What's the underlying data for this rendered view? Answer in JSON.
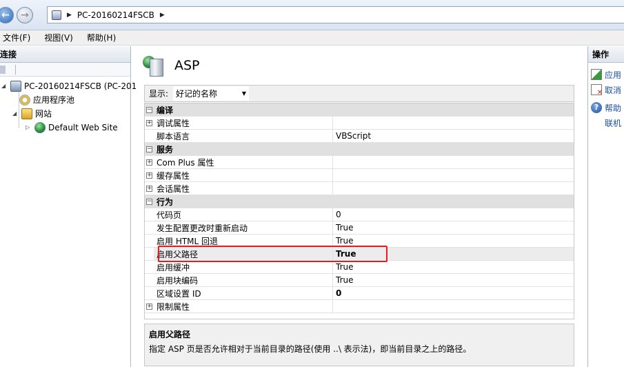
{
  "address": {
    "path": "PC-20160214FSCB"
  },
  "menu": [
    "文件(F)",
    "视图(V)",
    "帮助(H)"
  ],
  "connections": {
    "title": "连接",
    "tree": [
      {
        "label": "PC-20160214FSCB (PC-201"
      },
      {
        "label": "应用程序池"
      },
      {
        "label": "网站"
      },
      {
        "label": "Default Web Site"
      }
    ]
  },
  "feature": {
    "title": "ASP",
    "display_label": "显示:",
    "display_value": "好记的名称",
    "rows": [
      {
        "name": "编译",
        "value": "",
        "category": true
      },
      {
        "name": "调试属性",
        "value": ""
      },
      {
        "name": "脚本语言",
        "value": "VBScript"
      },
      {
        "name": "服务",
        "value": "",
        "category": true
      },
      {
        "name": "Com Plus 属性",
        "value": ""
      },
      {
        "name": "缓存属性",
        "value": ""
      },
      {
        "name": "会话属性",
        "value": ""
      },
      {
        "name": "行为",
        "value": "",
        "category": true
      },
      {
        "name": "代码页",
        "value": "0"
      },
      {
        "name": "发生配置更改时重新启动",
        "value": "True"
      },
      {
        "name": "启用 HTML 回退",
        "value": "True"
      },
      {
        "name": "启用父路径",
        "value": "True",
        "bold": true,
        "highlighted": true
      },
      {
        "name": "启用缓冲",
        "value": "True"
      },
      {
        "name": "启用块编码",
        "value": "True"
      },
      {
        "name": "区域设置 ID",
        "value": "0",
        "bold": true
      },
      {
        "name": "限制属性",
        "value": ""
      }
    ],
    "description_title": "启用父路径",
    "description_text": "指定 ASP 页是否允许相对于当前目录的路径(使用 ..\\ 表示法)，即当前目录之上的路径。"
  },
  "actions": {
    "title": "操作",
    "items": [
      {
        "label": "应用",
        "icon": "apply-icon"
      },
      {
        "label": "取消",
        "icon": "cancel-icon"
      },
      {
        "label": "帮助",
        "icon": "help-icon"
      },
      {
        "label": "联机",
        "icon": ""
      }
    ]
  }
}
